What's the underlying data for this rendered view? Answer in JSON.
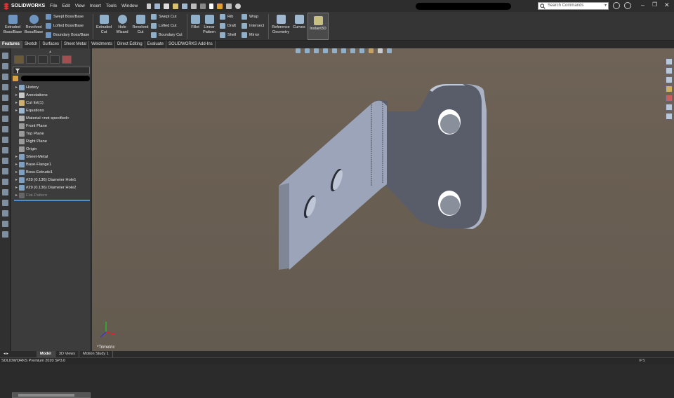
{
  "app": {
    "name": "SOLIDWORKS"
  },
  "menu": [
    "File",
    "Edit",
    "View",
    "Insert",
    "Tools",
    "Window"
  ],
  "search": {
    "placeholder": "Search Commands"
  },
  "ribbon": {
    "extruded_boss": "Extruded\nBoss/Base",
    "revolved_boss": "Revolved\nBoss/Base",
    "swept_boss": "Swept Boss/Base",
    "lofted_boss": "Lofted Boss/Base",
    "boundary_boss": "Boundary Boss/Base",
    "extruded_cut": "Extruded\nCut",
    "hole_wizard": "Hole\nWizard",
    "revolved_cut": "Revolved\nCut",
    "swept_cut": "Swept Cut",
    "lofted_cut": "Lofted Cut",
    "boundary_cut": "Boundary Cut",
    "fillet": "Fillet",
    "linear_pattern": "Linear\nPattern",
    "rib": "Rib",
    "draft": "Draft",
    "shell": "Shell",
    "wrap": "Wrap",
    "intersect": "Intersect",
    "mirror": "Mirror",
    "reference_geometry": "Reference\nGeometry",
    "curves": "Curves",
    "instant3d": "Instant3D"
  },
  "tabs": [
    {
      "label": "Features",
      "active": true
    },
    {
      "label": "Sketch"
    },
    {
      "label": "Surfaces"
    },
    {
      "label": "Sheet Metal"
    },
    {
      "label": "Weldments"
    },
    {
      "label": "Direct Editing"
    },
    {
      "label": "Evaluate"
    },
    {
      "label": "SOLIDWORKS Add-Ins"
    }
  ],
  "tree": {
    "items": [
      {
        "label": "History",
        "arrow": "▸",
        "icon": "history-icon",
        "color": "#8aa8c8"
      },
      {
        "label": "Annotations",
        "arrow": "▸",
        "icon": "annotations-icon",
        "color": "#c8c8c8"
      },
      {
        "label": "Cut list(1)",
        "arrow": "▸",
        "icon": "cut-list-icon",
        "color": "#d0b070"
      },
      {
        "label": "Equations",
        "arrow": "▸",
        "icon": "equations-icon",
        "color": "#9fb8d0"
      },
      {
        "label": "Material <not specified>",
        "arrow": "",
        "icon": "material-icon",
        "color": "#b0b0b0"
      },
      {
        "label": "Front Plane",
        "arrow": "",
        "icon": "plane-icon",
        "color": "#9a9a9a"
      },
      {
        "label": "Top Plane",
        "arrow": "",
        "icon": "plane-icon",
        "color": "#9a9a9a"
      },
      {
        "label": "Right Plane",
        "arrow": "",
        "icon": "plane-icon",
        "color": "#9a9a9a"
      },
      {
        "label": "Origin",
        "arrow": "",
        "icon": "origin-icon",
        "color": "#9a9a9a"
      },
      {
        "label": "Sheet-Metal",
        "arrow": "▸",
        "icon": "sheet-metal-icon",
        "color": "#7fa0c0"
      },
      {
        "label": "Base-Flange1",
        "arrow": "▸",
        "icon": "base-flange-icon",
        "color": "#7fa0c0"
      },
      {
        "label": "Boss-Extrude1",
        "arrow": "▸",
        "icon": "boss-extrude-icon",
        "color": "#7fa0c0"
      },
      {
        "label": "#29 (0.136) Diameter Hole1",
        "arrow": "▸",
        "icon": "hole-icon",
        "color": "#7fa0c0"
      },
      {
        "label": "#29 (0.136) Diameter Hole2",
        "arrow": "▸",
        "icon": "hole-icon",
        "color": "#7fa0c0"
      },
      {
        "label": "Flat-Pattern",
        "arrow": "▸",
        "icon": "flat-pattern-icon",
        "color": "#666666",
        "dim": true
      }
    ]
  },
  "view": {
    "orientation": "*Trimetric"
  },
  "bottom_tabs": [
    {
      "label": "Model",
      "active": true
    },
    {
      "label": "3D Views"
    },
    {
      "label": "Motion Study 1"
    }
  ],
  "status": {
    "left": "SOLIDWORKS Premium 2020 SP3.0",
    "units": "IPS"
  }
}
